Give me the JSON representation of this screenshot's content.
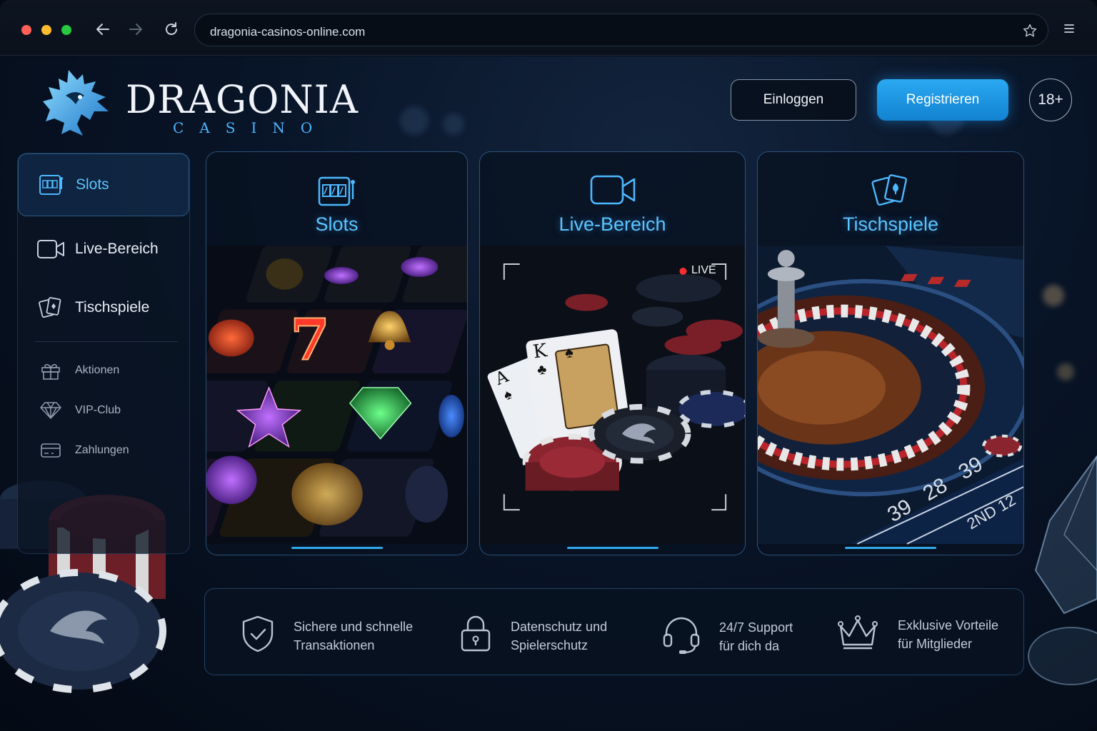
{
  "browser": {
    "url": "dragonia-casinos-online.com",
    "traffic_lights": [
      "#ff5f57",
      "#febc2e",
      "#28c840"
    ],
    "icons": [
      "back-arrow-icon",
      "forward-arrow-icon",
      "reload-icon",
      "bookmark-star-icon",
      "menu-icon"
    ]
  },
  "brand": {
    "name": "DRAGONIA",
    "subtitle": "CASINO",
    "accent_color": "#3aaef5"
  },
  "header": {
    "login_label": "Einloggen",
    "register_label": "Registrieren",
    "age_badge": "18+"
  },
  "sidebar": {
    "items": [
      {
        "label": "Slots",
        "icon": "slot-machine-icon",
        "active": true
      },
      {
        "label": "Live-Bereich",
        "icon": "video-camera-icon"
      },
      {
        "label": "Tischspiele",
        "icon": "playing-cards-icon"
      },
      {
        "label": "Aktionen",
        "icon": "gift-icon"
      },
      {
        "label": "VIP-Club",
        "icon": "diamond-icon"
      },
      {
        "label": "Zahlungen",
        "icon": "credit-card-icon"
      }
    ]
  },
  "cards": [
    {
      "title": "Slots",
      "icon": "slot-machine-icon"
    },
    {
      "title": "Live-Bereich",
      "icon": "video-camera-icon",
      "live_badge": "LIVE"
    },
    {
      "title": "Tischspiele",
      "icon": "playing-cards-icon"
    }
  ],
  "features": [
    {
      "line1": "Sichere und schnelle",
      "line2": "Transaktionen",
      "icon": "shield-check-icon"
    },
    {
      "line1": "Datenschutz und",
      "line2": "Spielerschutz",
      "icon": "padlock-icon"
    },
    {
      "line1": "24/7 Support",
      "line2": "für dich da",
      "icon": "headset-icon"
    },
    {
      "line1": "Exklusive Vorteile",
      "line2": "für Mitglieder",
      "icon": "crown-icon"
    }
  ]
}
